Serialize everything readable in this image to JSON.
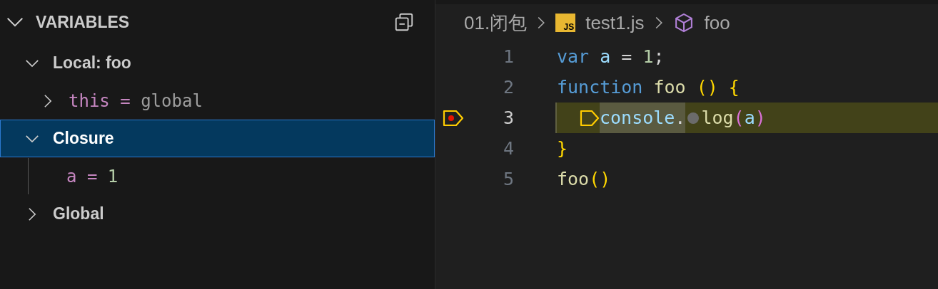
{
  "variables_panel": {
    "title": "VARIABLES",
    "expanded": true,
    "tree": [
      {
        "kind": "scope",
        "label": "Local: foo",
        "expanded": true,
        "selected": false,
        "children": [
          {
            "kind": "object-variable",
            "name": "this",
            "operator": "=",
            "value": "global",
            "expanded": false,
            "selected": false
          }
        ]
      },
      {
        "kind": "scope",
        "label": "Closure",
        "expanded": true,
        "selected": true,
        "children": [
          {
            "kind": "value-variable",
            "name": "a",
            "operator": "=",
            "value": "1",
            "selected": false
          }
        ]
      },
      {
        "kind": "scope",
        "label": "Global",
        "expanded": false,
        "selected": false
      }
    ]
  },
  "editor": {
    "breadcrumbs": [
      {
        "kind": "folder",
        "label": "01.闭包"
      },
      {
        "kind": "file",
        "label": "test1.js",
        "icon_text": "JS"
      },
      {
        "kind": "symbol",
        "label": "foo"
      }
    ],
    "lines": [
      {
        "number": "1",
        "current": false,
        "breakpoint": false,
        "tokens": [
          {
            "kind": "keyword",
            "text": "var"
          },
          {
            "kind": "variable",
            "text": " a"
          },
          {
            "kind": "plain",
            "text": " = "
          },
          {
            "kind": "number",
            "text": "1"
          },
          {
            "kind": "plain",
            "text": ";"
          }
        ]
      },
      {
        "number": "2",
        "current": false,
        "breakpoint": false,
        "tokens": [
          {
            "kind": "keyword",
            "text": "function"
          },
          {
            "kind": "function",
            "text": " foo "
          },
          {
            "kind": "bracket",
            "text": "() {"
          }
        ]
      },
      {
        "number": "3",
        "current": true,
        "breakpoint": true,
        "tokens": [
          {
            "kind": "stop-marker"
          },
          {
            "kind": "variable",
            "text": "console",
            "range": true
          },
          {
            "kind": "plain",
            "text": ".",
            "range": true
          },
          {
            "kind": "inline-breakpoint"
          },
          {
            "kind": "function",
            "text": "log"
          },
          {
            "kind": "bracket2",
            "text": "("
          },
          {
            "kind": "variable",
            "text": "a"
          },
          {
            "kind": "bracket2",
            "text": ")"
          }
        ]
      },
      {
        "number": "4",
        "current": false,
        "breakpoint": false,
        "tokens": [
          {
            "kind": "bracket",
            "text": "}"
          }
        ]
      },
      {
        "number": "5",
        "current": false,
        "breakpoint": false,
        "tokens": [
          {
            "kind": "function",
            "text": "foo"
          },
          {
            "kind": "bracket",
            "text": "()"
          }
        ]
      }
    ]
  }
}
